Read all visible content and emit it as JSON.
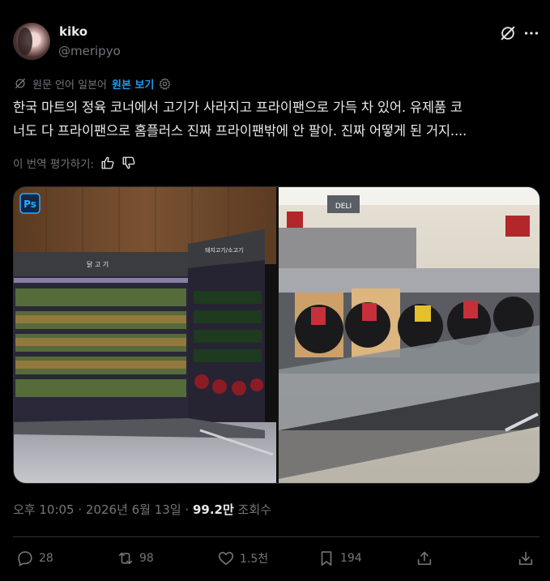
{
  "user": {
    "name": "kiko",
    "handle": "@meripyo"
  },
  "translation": {
    "label": "원문 언어 일본어",
    "show_original": "원본 보기"
  },
  "tweet": {
    "text": "한국 마트의 정육 코너에서 고기가 사라지고 프라이팬으로 가득 차 있어. 유제품 코\n너도 다 프라이팬으로 홈플러스 진짜 프라이팬밖에 안 팔아. 진짜 어떻게 된 거지...."
  },
  "rating": {
    "label": "이 번역 평가하기:"
  },
  "media": {
    "ps_badge": "Ps",
    "sign_meat": "닭 고 기",
    "sign_pork": "돼지고기/소고기",
    "sign_deli": "DELI"
  },
  "meta": {
    "time": "오후 10:05 · 2026년 6월 13일 · ",
    "views_count": "99.2만",
    "views_label": " 조회수"
  },
  "actions": {
    "replies": "28",
    "reposts": "98",
    "likes": "1.5천",
    "bookmarks": "194"
  },
  "colors": {
    "accent": "#1d9bf0",
    "muted": "#71767b",
    "text": "#e7e9ea",
    "background": "#000000"
  }
}
